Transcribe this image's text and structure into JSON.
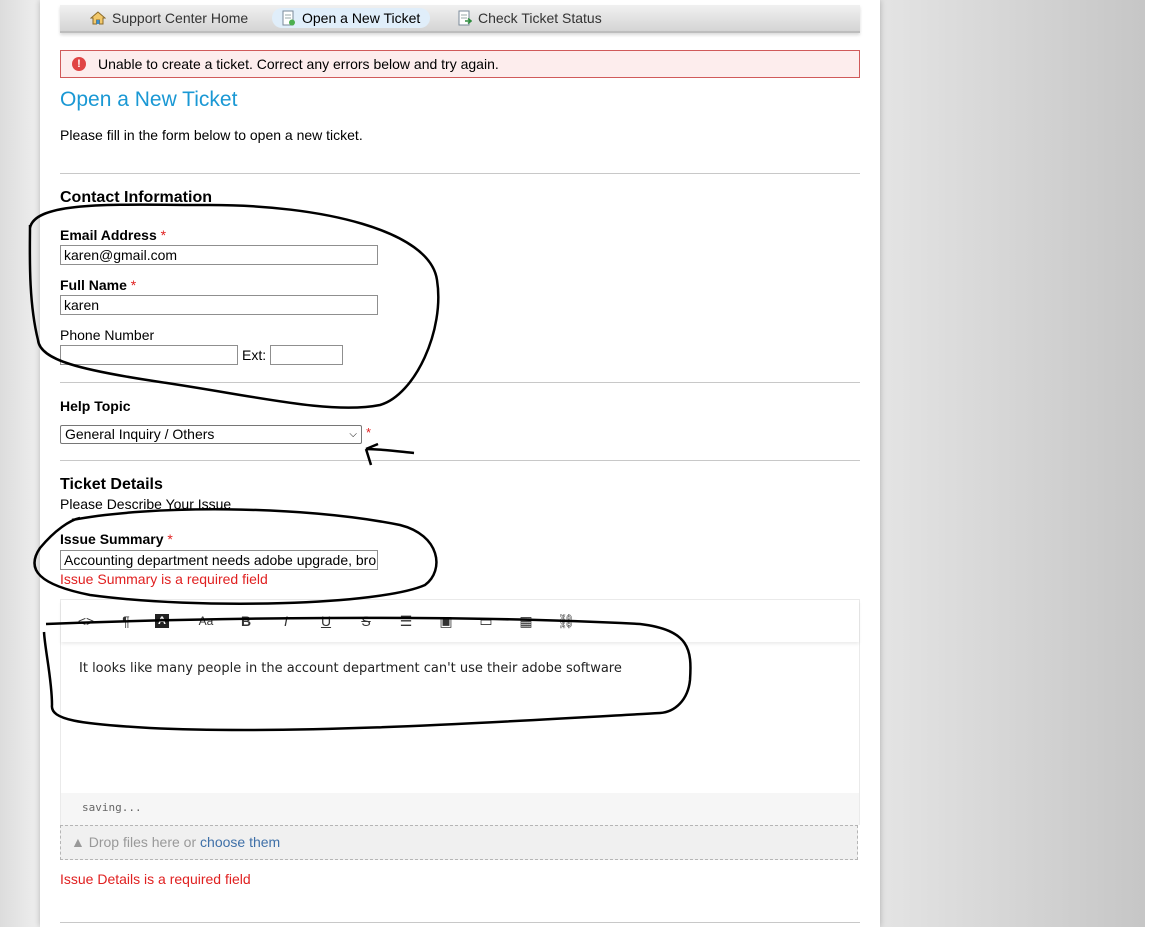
{
  "nav": {
    "home": "Support Center Home",
    "new_ticket": "Open a New Ticket",
    "status": "Check Ticket Status"
  },
  "alert": {
    "icon": "!",
    "text": "Unable to create a ticket. Correct any errors below and try again."
  },
  "page_title": "Open a New Ticket",
  "intro": "Please fill in the form below to open a new ticket.",
  "contact": {
    "title": "Contact Information",
    "email_label": "Email Address",
    "email_value": "karen@gmail.com",
    "name_label": "Full Name",
    "name_value": "karen",
    "phone_label": "Phone Number",
    "phone_value": "",
    "ext_label": "Ext:",
    "ext_value": "",
    "required_mark": "*"
  },
  "help_topic": {
    "label": "Help Topic",
    "selected": "General Inquiry / Others",
    "required_mark": "*"
  },
  "details": {
    "title": "Ticket Details",
    "subtitle": "Please Describe Your Issue",
    "summary_label": "Issue Summary",
    "summary_value": "Accounting department needs adobe upgrade, bro",
    "summary_error": "Issue Summary is a required field",
    "required_mark": "*",
    "editor_text": "It looks like many people in the account department can't use their adobe software",
    "editor_status": "saving...",
    "dropzone_text": "Drop files here or ",
    "dropzone_link": "choose them",
    "details_error": "Issue Details is a required field"
  },
  "toolbar": {
    "code": "<>",
    "paragraph": "¶",
    "format": "A",
    "font": "Aa",
    "bold": "B",
    "italic": "I",
    "underline": "U",
    "strike": "S",
    "list": "☰",
    "image": "▣",
    "video": "▭",
    "table": "▦",
    "link": "⛓"
  },
  "colors": {
    "accent": "#1a98d4",
    "error": "#e02020",
    "annotation": "#000000"
  }
}
